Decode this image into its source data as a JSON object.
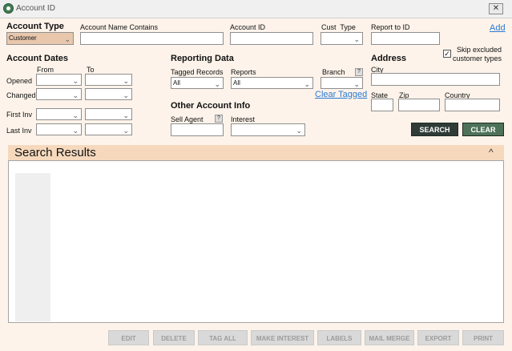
{
  "window": {
    "title": "Account ID",
    "close_glyph": "✕",
    "icon": "app-globe-icon"
  },
  "account_type": {
    "heading": "Account Type",
    "selected": "Customer"
  },
  "account_name": {
    "label": "Account Name Contains",
    "value": ""
  },
  "account_id": {
    "label": "Account ID",
    "value": ""
  },
  "cust_type": {
    "label": "Cust  Type",
    "selected": ""
  },
  "report_to_id": {
    "label": "Report to ID",
    "value": ""
  },
  "add_link": "Add",
  "account_dates": {
    "heading": "Account Dates",
    "from_label": "From",
    "to_label": "To",
    "rows": [
      {
        "label": "Opened"
      },
      {
        "label": "Changed"
      },
      {
        "label": "First Inv"
      },
      {
        "label": "Last Inv"
      }
    ]
  },
  "reporting_data": {
    "heading": "Reporting Data",
    "tagged_records_label": "Tagged Records",
    "tagged_records_selected": "All",
    "reports_label": "Reports",
    "reports_selected": "All",
    "branch_label": "Branch",
    "branch_selected": "",
    "help_glyph": "?",
    "clear_tagged_link": "Clear Tagged"
  },
  "other_account_info": {
    "heading": "Other Account Info",
    "sell_agent_label": "Sell Agent",
    "sell_agent_value": "",
    "interest_label": "Interest",
    "interest_selected": ""
  },
  "address": {
    "heading": "Address",
    "skip_excluded_label_line1": "Skip excluded",
    "skip_excluded_label_line2": "customer types",
    "skip_excluded_checked": true,
    "check_glyph": "✓",
    "city_label": "City",
    "state_label": "State",
    "zip_label": "Zip",
    "country_label": "Country"
  },
  "actions": {
    "search": "SEARCH",
    "clear": "CLEAR"
  },
  "search_results": {
    "title": "Search Results",
    "collapse_glyph": "^"
  },
  "bottom_buttons": {
    "edit": "EDIT",
    "delete": "DELETE",
    "tag_all": "TAG ALL",
    "make_interest": "MAKE INTEREST",
    "labels": "LABELS",
    "mail_merge": "MAIL MERGE",
    "export": "EXPORT",
    "print": "PRINT"
  },
  "colors": {
    "background": "#fdf3ea",
    "results_header": "#f6d9bd",
    "search_button": "#2f3b36",
    "clear_button": "#4d7259",
    "link": "#2a7ad2"
  }
}
